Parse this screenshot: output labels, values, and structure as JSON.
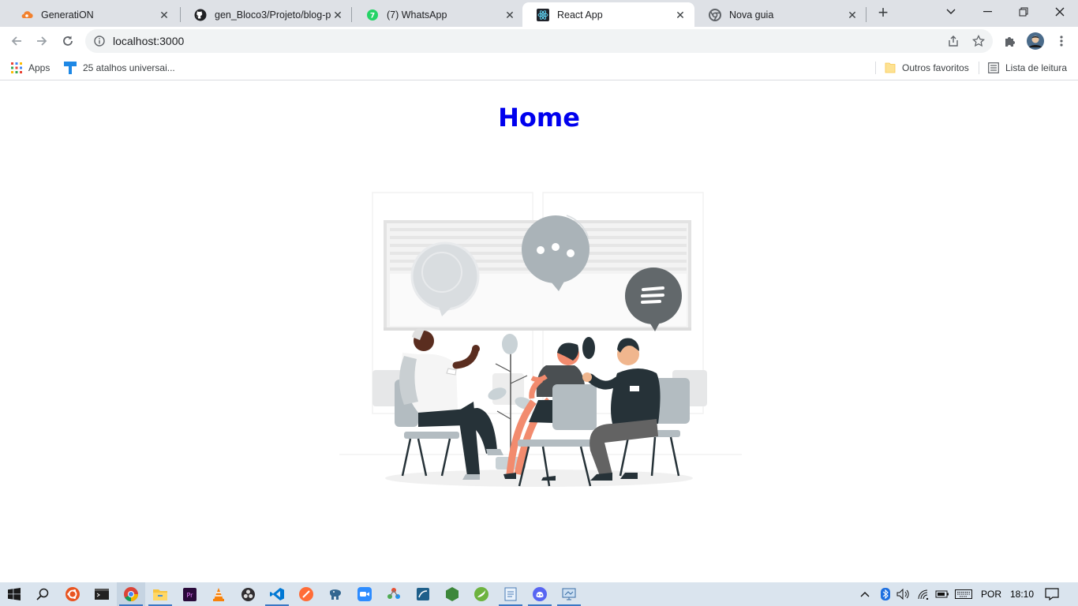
{
  "browser": {
    "tabs": [
      {
        "title": "GeneratiON",
        "icon": "cloud-icon",
        "active": false
      },
      {
        "title": "gen_Bloco3/Projeto/blog-pe",
        "icon": "github-icon",
        "active": false
      },
      {
        "title": "(7) WhatsApp",
        "icon": "whatsapp-icon",
        "active": false
      },
      {
        "title": "React App",
        "icon": "react-icon",
        "active": true
      },
      {
        "title": "Nova guia",
        "icon": "chrome-icon",
        "active": false
      }
    ],
    "url": "localhost:3000",
    "bookmarks": {
      "apps": "Apps",
      "shortcut": "25 atalhos universai...",
      "others": "Outros favoritos",
      "reading_list": "Lista de leitura"
    }
  },
  "page": {
    "title": "Home"
  },
  "taskbar": {
    "language": "POR",
    "time": "18:10"
  },
  "colors": {
    "title": "#0000ee",
    "tabstrip": "#dee1e6",
    "taskbar": "#dae4ee"
  }
}
